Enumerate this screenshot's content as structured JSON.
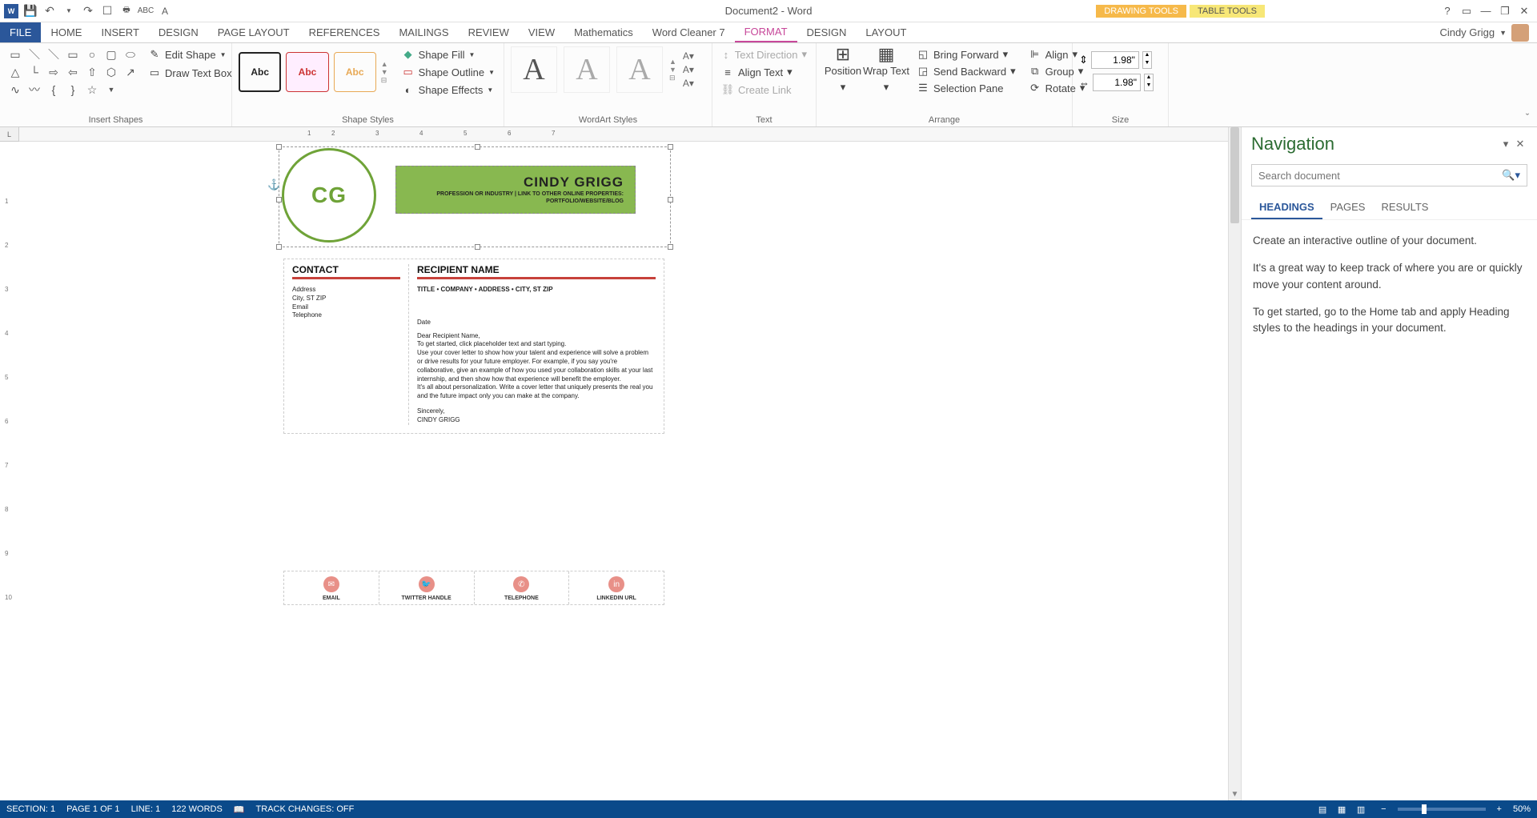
{
  "title": "Document2 - Word",
  "tool_tabs": {
    "drawing": "DRAWING TOOLS",
    "table": "TABLE TOOLS"
  },
  "user": {
    "name": "Cindy Grigg"
  },
  "ribbon_tabs": [
    "FILE",
    "HOME",
    "INSERT",
    "DESIGN",
    "PAGE LAYOUT",
    "REFERENCES",
    "MAILINGS",
    "REVIEW",
    "VIEW",
    "Mathematics",
    "Word Cleaner 7",
    "FORMAT",
    "DESIGN",
    "LAYOUT"
  ],
  "ribbon": {
    "insert_shapes": {
      "edit_shape": "Edit Shape",
      "draw_text_box": "Draw Text Box",
      "label": "Insert Shapes"
    },
    "shape_styles": {
      "preset": "Abc",
      "fill": "Shape Fill",
      "outline": "Shape Outline",
      "effects": "Shape Effects",
      "label": "Shape Styles"
    },
    "wordart": {
      "label": "WordArt Styles"
    },
    "text": {
      "dir": "Text Direction",
      "align": "Align Text",
      "link": "Create Link",
      "label": "Text"
    },
    "arrange": {
      "position": "Position",
      "wrap": "Wrap Text",
      "fwd": "Bring Forward",
      "bwd": "Send Backward",
      "sel": "Selection Pane",
      "align": "Align",
      "group": "Group",
      "rotate": "Rotate",
      "label": "Arrange"
    },
    "size": {
      "h": "1.98\"",
      "w": "1.98\"",
      "label": "Size"
    }
  },
  "document": {
    "header_name": "CINDY GRIGG",
    "header_sub1": "PROFESSION OR INDUSTRY | LINK TO OTHER ONLINE PROPERTIES:",
    "header_sub2": "PORTFOLIO/WEBSITE/BLOG",
    "initials": "CG",
    "contact_head": "CONTACT",
    "contact_lines": [
      "Address",
      "City, ST ZIP",
      "Email",
      "Telephone"
    ],
    "recipient_head": "RECIPIENT NAME",
    "recipient_sub": "TITLE • COMPANY • ADDRESS • CITY, ST ZIP",
    "date": "Date",
    "greeting": "Dear Recipient Name,",
    "p1": "To get started, click placeholder text and start typing.",
    "p2": "Use your cover letter to show how your talent and experience will solve a problem or drive results for your future employer. For example, if you say you're collaborative, give an example of how you used your collaboration skills at your last internship, and then show how that experience will benefit the employer.",
    "p3": "It's all about personalization. Write a cover letter that uniquely presents the real you and the future impact only you can make at the company.",
    "closing": "Sincerely,",
    "signature": "CINDY GRIGG",
    "footer": [
      "EMAIL",
      "TWITTER HANDLE",
      "TELEPHONE",
      "LINKEDIN URL"
    ]
  },
  "nav": {
    "title": "Navigation",
    "search_ph": "Search document",
    "tabs": [
      "HEADINGS",
      "PAGES",
      "RESULTS"
    ],
    "p1": "Create an interactive outline of your document.",
    "p2": "It's a great way to keep track of where you are or quickly move your content around.",
    "p3": "To get started, go to the Home tab and apply Heading styles to the headings in your document."
  },
  "status": {
    "section": "SECTION: 1",
    "page": "PAGE 1 OF 1",
    "line": "LINE: 1",
    "words": "122 WORDS",
    "track": "TRACK CHANGES: OFF",
    "zoom": "50%"
  }
}
